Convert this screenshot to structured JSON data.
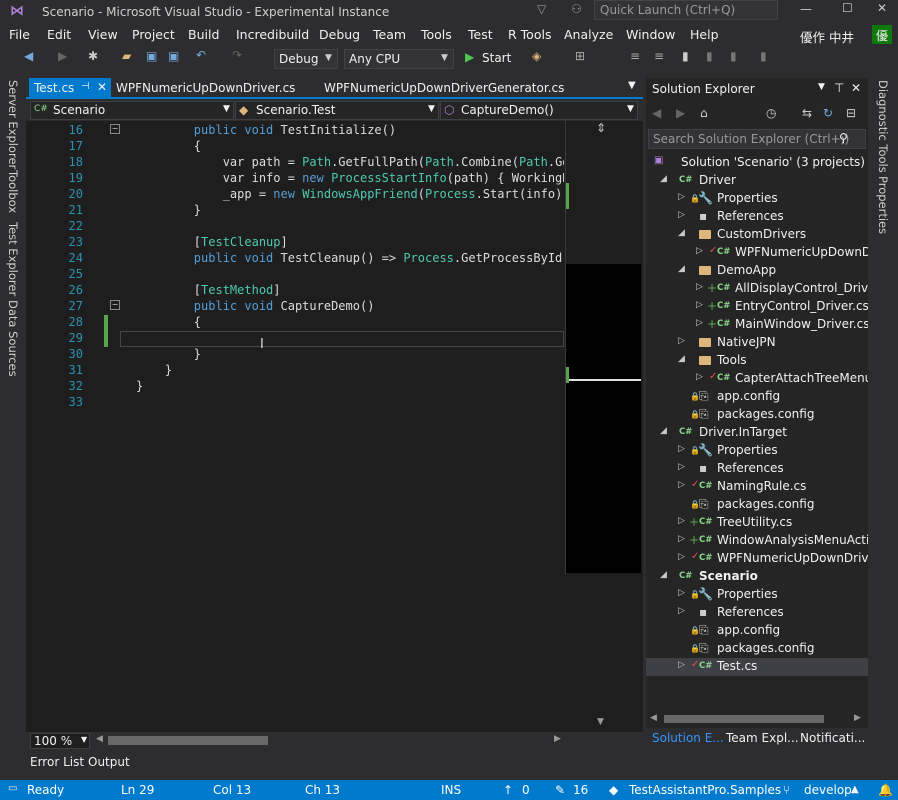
{
  "window": {
    "title": "Scenario - Microsoft Visual Studio  - Experimental Instance",
    "quick_launch": "Quick Launch (Ctrl+Q)",
    "user": "優作 中井",
    "user_badge": "優"
  },
  "menu": [
    "File",
    "Edit",
    "View",
    "Project",
    "Build",
    "Incredibuild",
    "Debug",
    "Team",
    "Tools",
    "Test",
    "R Tools",
    "Analyze",
    "Window",
    "Help"
  ],
  "toolbar": {
    "config": "Debug",
    "platform": "Any CPU",
    "start": "Start"
  },
  "left_tabs": [
    "Server Explorer",
    "Toolbox",
    "Test Explorer",
    "Data Sources"
  ],
  "right_tabs": [
    "Diagnostic Tools",
    "Properties"
  ],
  "doc_tabs": [
    "Test.cs",
    "WPFNumericUpDownDriver.cs",
    "WPFNumericUpDownDriverGenerator.cs"
  ],
  "nav": {
    "project": "Scenario",
    "class": "Scenario.Test",
    "member": "CaptureDemo()"
  },
  "code": {
    "lines": [
      "16",
      "17",
      "18",
      "19",
      "20",
      "21",
      "22",
      "23",
      "24",
      "25",
      "26",
      "27",
      "28",
      "29",
      "30",
      "31",
      "32",
      "33"
    ],
    "l16a": "        public void ",
    "l16b": "TestInitialize()",
    "l17": "        {",
    "l18a": "            var path = ",
    "l18b": "Path",
    ".": ".",
    "l18c": ".GetFullPath(",
    "l18d": "Path",
    "l18e": ".Combine(",
    "l18f": "Path",
    "l18g": ".GetDi",
    "l19a": "            var info = ",
    "l19b": "new ",
    "l19c": "ProcessStartInfo",
    "l19d": "(path) { WorkingDire",
    "l20a": "            _app = ",
    "l20b": "new ",
    "l20c": "WindowsAppFriend",
    "l20d": "(",
    "l20e": "Process",
    "l20f": ".Start(info));",
    "l21": "        }",
    "l23a": "        [",
    "l23b": "TestCleanup",
    "l23c": "]",
    "l24a": "        public void ",
    "l24b": "TestCleanup() => ",
    "l24c": "Process",
    "l24d": ".GetProcessById(_app",
    "l26a": "        [",
    "l26b": "TestMethod",
    "l26c": "]",
    "l27a": "        public void ",
    "l27b": "CaptureDemo()",
    "l28": "        {",
    "l30": "        }",
    "l31": "    }",
    "l32": "}"
  },
  "editor_footer": {
    "zoom": "100 %"
  },
  "solution": {
    "title": "Solution Explorer",
    "search": "Search Solution Explorer (Ctrl+;)",
    "items": [
      "Solution 'Scenario' (3 projects)",
      "Driver",
      "Properties",
      "References",
      "CustomDrivers",
      "WPFNumericUpDownDriv",
      "DemoApp",
      "AllDisplayControl_Driver.c",
      "EntryControl_Driver.cs",
      "MainWindow_Driver.cs",
      "NativeJPN",
      "Tools",
      "CapterAttachTreeMenuAc",
      "app.config",
      "packages.config",
      "Driver.InTarget",
      "Properties",
      "References",
      "NamingRule.cs",
      "packages.config",
      "TreeUtility.cs",
      "WindowAnalysisMenuAction",
      "WPFNumericUpDownDriverG",
      "Scenario",
      "Properties",
      "References",
      "app.config",
      "packages.config",
      "Test.cs"
    ],
    "bottom_tabs": [
      "Solution E...",
      "Team Expl...",
      "Notificati..."
    ]
  },
  "output_tabs": [
    "Error List",
    "Output"
  ],
  "status": {
    "ready": "Ready",
    "ln": "Ln 29",
    "col": "Col 13",
    "ch": "Ch 13",
    "ins": "INS",
    "up": "0",
    "edits": "16",
    "repo": "TestAssistantPro.Samples",
    "branch": "develop"
  },
  "colors": {
    "accent": "#007acc",
    "editor_bg": "#1e1e1e",
    "keyword": "#569cd6",
    "type": "#4ec9b0"
  }
}
